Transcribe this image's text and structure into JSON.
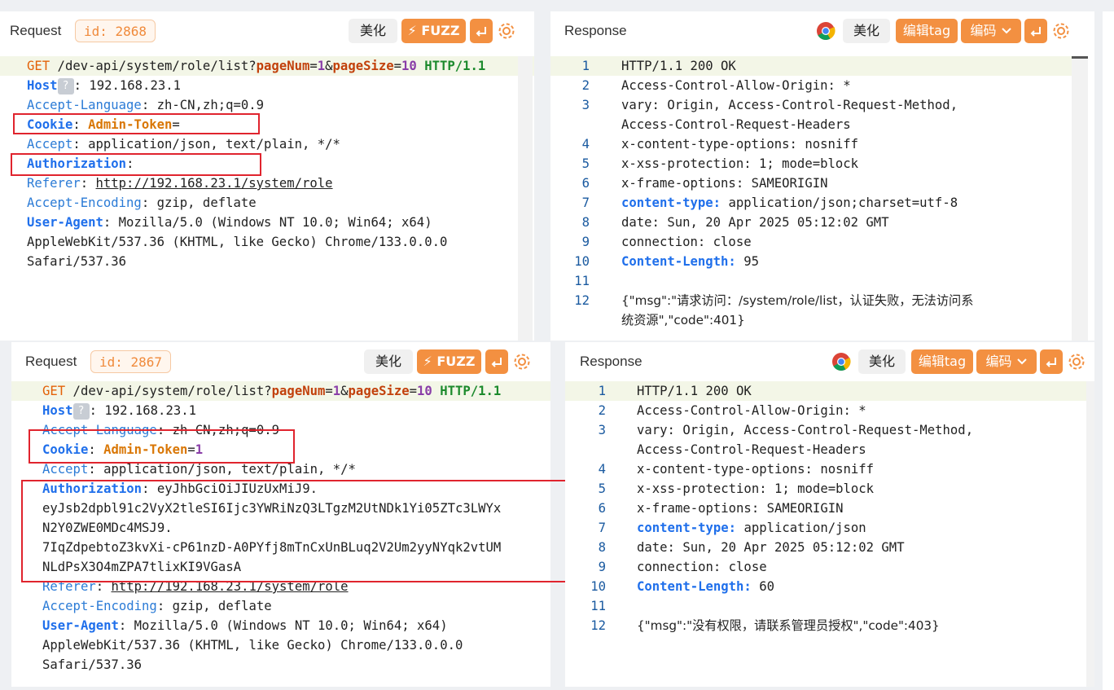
{
  "panels": {
    "req1": {
      "title": "Request",
      "id_label": "id: 2868",
      "beautify": "美化",
      "fuzz": "⚡ FUZZ",
      "lines": [
        {
          "method": "GET",
          "path": " /dev-api/system/role/list?",
          "p1": "pageNum",
          "eq1": "=",
          "v1": "1",
          "amp": "&",
          "p2": "pageSize",
          "eq2": "=",
          "v2": "10",
          "proto": " HTTP/1.1"
        },
        {
          "name": "Host",
          "q": "?",
          "rest": ": 192.168.23.1"
        },
        {
          "name": "Accept-Language",
          "rest": ": zh-CN,zh;q=0.9"
        },
        {
          "name": "Cookie",
          "sep": ": ",
          "cookie": "Admin-Token",
          "eq": "="
        },
        {
          "name": "Accept",
          "rest": ": application/json, text/plain, */*"
        },
        {
          "name": "Authorization",
          "rest": ":"
        },
        {
          "name": "Referer",
          "sep": ": ",
          "url": "http://192.168.23.1/system/role"
        },
        {
          "name": "Accept-Encoding",
          "rest": ": gzip, deflate"
        },
        {
          "name": "User-Agent",
          "rest": ": Mozilla/5.0 (Windows NT 10.0; Win64; x64)"
        },
        {
          "text": "AppleWebKit/537.36 (KHTML, like Gecko) Chrome/133.0.0.0"
        },
        {
          "text": "Safari/537.36"
        }
      ]
    },
    "resp1": {
      "title": "Response",
      "beautify": "美化",
      "edit_tag": "编辑tag",
      "encode": "编码",
      "lines": [
        {
          "n": "1",
          "text": "HTTP/1.1 200 OK"
        },
        {
          "n": "2",
          "text": "Access-Control-Allow-Origin: *"
        },
        {
          "n": "3",
          "text": "vary: Origin, Access-Control-Request-Method,"
        },
        {
          "n": "",
          "text": "Access-Control-Request-Headers"
        },
        {
          "n": "4",
          "text": "x-content-type-options: nosniff"
        },
        {
          "n": "5",
          "text": "x-xss-protection: 1; mode=block"
        },
        {
          "n": "6",
          "text": "x-frame-options: SAMEORIGIN"
        },
        {
          "n": "7",
          "key": "content-type:",
          "text": " application/json;charset=utf-8"
        },
        {
          "n": "8",
          "text": "date: Sun, 20 Apr 2025 05:12:02 GMT"
        },
        {
          "n": "9",
          "text": "connection: close"
        },
        {
          "n": "10",
          "key": "Content-Length:",
          "text": " 95"
        },
        {
          "n": "11",
          "text": ""
        },
        {
          "n": "12",
          "text": "{\"msg\":\"请求访问：/system/role/list，认证失败，无法访问系"
        },
        {
          "n": "",
          "text": "统资源\",\"code\":401}"
        }
      ]
    },
    "req2": {
      "title": "Request",
      "id_label": "id: 2867",
      "beautify": "美化",
      "fuzz": "⚡ FUZZ",
      "lines": [
        {
          "method": "GET",
          "path": " /dev-api/system/role/list?",
          "p1": "pageNum",
          "eq1": "=",
          "v1": "1",
          "amp": "&",
          "p2": "pageSize",
          "eq2": "=",
          "v2": "10",
          "proto": " HTTP/1.1"
        },
        {
          "name": "Host",
          "q": "?",
          "rest": ": 192.168.23.1"
        },
        {
          "name": "Accept-Language",
          "rest": ": zh-CN,zh;q=0.9"
        },
        {
          "name": "Cookie",
          "sep": ": ",
          "cookie": "Admin-Token",
          "eq": "=",
          "cv": "1"
        },
        {
          "name": "Accept",
          "rest": ": application/json, text/plain, */*"
        },
        {
          "name": "Authorization",
          "rest": ": eyJhbGciOiJIUzUxMiJ9."
        },
        {
          "text": "eyJsb2dpbl91c2VyX2tleSI6Ijc3YWRiNzQ3LTgzM2UtNDk1Yi05ZTc3LWYx"
        },
        {
          "text": "N2Y0ZWE0MDc4MSJ9."
        },
        {
          "text": "7IqZdpebtoZ3kvXi-cP61nzD-A0PYfj8mTnCxUnBLuq2V2Um2yyNYqk2vtUM"
        },
        {
          "text": "NLdPsX3O4mZPA7tlixKI9VGasA"
        },
        {
          "name": "Referer",
          "sep": ": ",
          "url": "http://192.168.23.1/system/role"
        },
        {
          "name": "Accept-Encoding",
          "rest": ": gzip, deflate"
        },
        {
          "name": "User-Agent",
          "rest": ": Mozilla/5.0 (Windows NT 10.0; Win64; x64)"
        },
        {
          "text": "AppleWebKit/537.36 (KHTML, like Gecko) Chrome/133.0.0.0"
        },
        {
          "text": "Safari/537.36"
        }
      ]
    },
    "resp2": {
      "title": "Response",
      "beautify": "美化",
      "edit_tag": "编辑tag",
      "encode": "编码",
      "lines": [
        {
          "n": "1",
          "text": "HTTP/1.1 200 OK"
        },
        {
          "n": "2",
          "text": "Access-Control-Allow-Origin: *"
        },
        {
          "n": "3",
          "text": "vary: Origin, Access-Control-Request-Method,"
        },
        {
          "n": "",
          "text": "Access-Control-Request-Headers"
        },
        {
          "n": "4",
          "text": "x-content-type-options: nosniff"
        },
        {
          "n": "5",
          "text": "x-xss-protection: 1; mode=block"
        },
        {
          "n": "6",
          "text": "x-frame-options: SAMEORIGIN"
        },
        {
          "n": "7",
          "key": "content-type:",
          "text": " application/json"
        },
        {
          "n": "8",
          "text": "date: Sun, 20 Apr 2025 05:12:02 GMT"
        },
        {
          "n": "9",
          "text": "connection: close"
        },
        {
          "n": "10",
          "key": "Content-Length:",
          "text": " 60"
        },
        {
          "n": "11",
          "text": ""
        },
        {
          "n": "12",
          "text": "{\"msg\":\"没有权限，请联系管理员授权\",\"code\":403}"
        }
      ]
    }
  },
  "colors": {
    "accent": "#f39041",
    "highlight_box": "#e0242e",
    "header_blue": "#1f6feb"
  }
}
